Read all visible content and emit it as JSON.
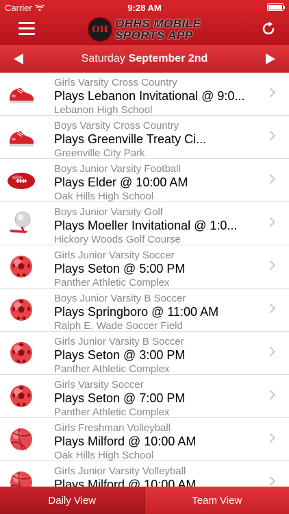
{
  "status_bar": {
    "carrier": "Carrier",
    "time": "9:28 AM"
  },
  "header": {
    "logo_seal": "OH",
    "logo_line1": "OHHS MOBILE",
    "logo_line2": "SPORTS APP",
    "menu_icon": "hamburger-icon",
    "refresh_icon": "refresh-icon"
  },
  "date_bar": {
    "weekday": "Saturday",
    "date": "September 2nd"
  },
  "events": [
    {
      "team": "Girls Varsity Cross Country",
      "event": "Plays Lebanon Invitational @ 9:0...",
      "location": "Lebanon High School",
      "icon": "running-shoe-icon"
    },
    {
      "team": "Boys Varsity Cross Country",
      "event": "Plays Greenville Treaty Ci...",
      "location": "Greenville City Park",
      "icon": "running-shoe-icon"
    },
    {
      "team": "Boys Junior Varsity Football",
      "event": "Plays Elder @ 10:00 AM",
      "location": "Oak Hills High School",
      "icon": "football-icon"
    },
    {
      "team": "Boys Junior Varsity Golf",
      "event": "Plays Moeller Invitational @ 1:0...",
      "location": "Hickory Woods Golf Course",
      "icon": "golf-ball-icon"
    },
    {
      "team": "Girls Junior Varsity Soccer",
      "event": "Plays Seton @ 5:00 PM",
      "location": "Panther Athletic Complex",
      "icon": "soccer-ball-icon"
    },
    {
      "team": "Boys Junior Varsity B Soccer",
      "event": "Plays Springboro @ 11:00 AM",
      "location": "Ralph E. Wade Soccer Field",
      "icon": "soccer-ball-icon"
    },
    {
      "team": "Girls Junior Varsity B Soccer",
      "event": "Plays Seton @ 3:00 PM",
      "location": "Panther Athletic Complex",
      "icon": "soccer-ball-icon"
    },
    {
      "team": "Girls Varsity Soccer",
      "event": "Plays Seton @ 7:00 PM",
      "location": "Panther Athletic Complex",
      "icon": "soccer-ball-icon"
    },
    {
      "team": "Girls Freshman Volleyball",
      "event": "Plays Milford @ 10:00 AM",
      "location": "Oak Hills High School",
      "icon": "volleyball-icon"
    },
    {
      "team": "Girls Junior Varsity Volleyball",
      "event": "Plays Milford @ 10:00 AM",
      "location": "",
      "icon": "volleyball-icon"
    }
  ],
  "tabs": [
    {
      "label": "Daily View",
      "active": true
    },
    {
      "label": "Team View",
      "active": false
    }
  ],
  "colors": {
    "brand_red": "#d8242b",
    "secondary_text": "#8a8a8a"
  }
}
